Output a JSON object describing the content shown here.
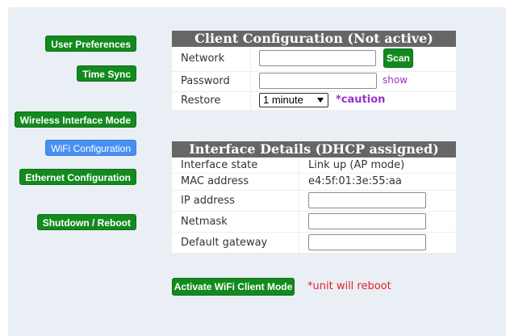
{
  "nav": {
    "user_preferences": "User Preferences",
    "time_sync": "Time Sync",
    "wireless_interface_mode": "Wireless Interface Mode",
    "wifi_configuration": "WiFi Configuration",
    "ethernet_configuration": "Ethernet Configuration",
    "shutdown_reboot": "Shutdown / Reboot",
    "active_item": "WiFi Configuration"
  },
  "client": {
    "title": "Client Configuration (Not active)",
    "network_label": "Network",
    "network_value": "",
    "scan_label": "Scan",
    "password_label": "Password",
    "password_value": "",
    "show_label": "show",
    "restore_label": "Restore",
    "restore_value": "1 minute",
    "caution_label": "*caution"
  },
  "interface": {
    "title": "Interface Details (DHCP assigned)",
    "state_label": "Interface state",
    "state_value": "Link up (AP mode)",
    "mac_label": "MAC address",
    "mac_value": "e4:5f:01:3e:55:aa",
    "ip_label": "IP address",
    "ip_value": "",
    "netmask_label": "Netmask",
    "netmask_value": "",
    "gateway_label": "Default gateway",
    "gateway_value": ""
  },
  "activate": {
    "button_label": "Activate WiFi Client Mode",
    "warning": "*unit will reboot"
  },
  "colors": {
    "button_green": "#138a1e",
    "active_blue": "#4a8ff0",
    "header_gray": "#666666",
    "panel_bg": "#eaeff5",
    "link_purple": "#9933cc",
    "warning_red": "#e8202a"
  }
}
